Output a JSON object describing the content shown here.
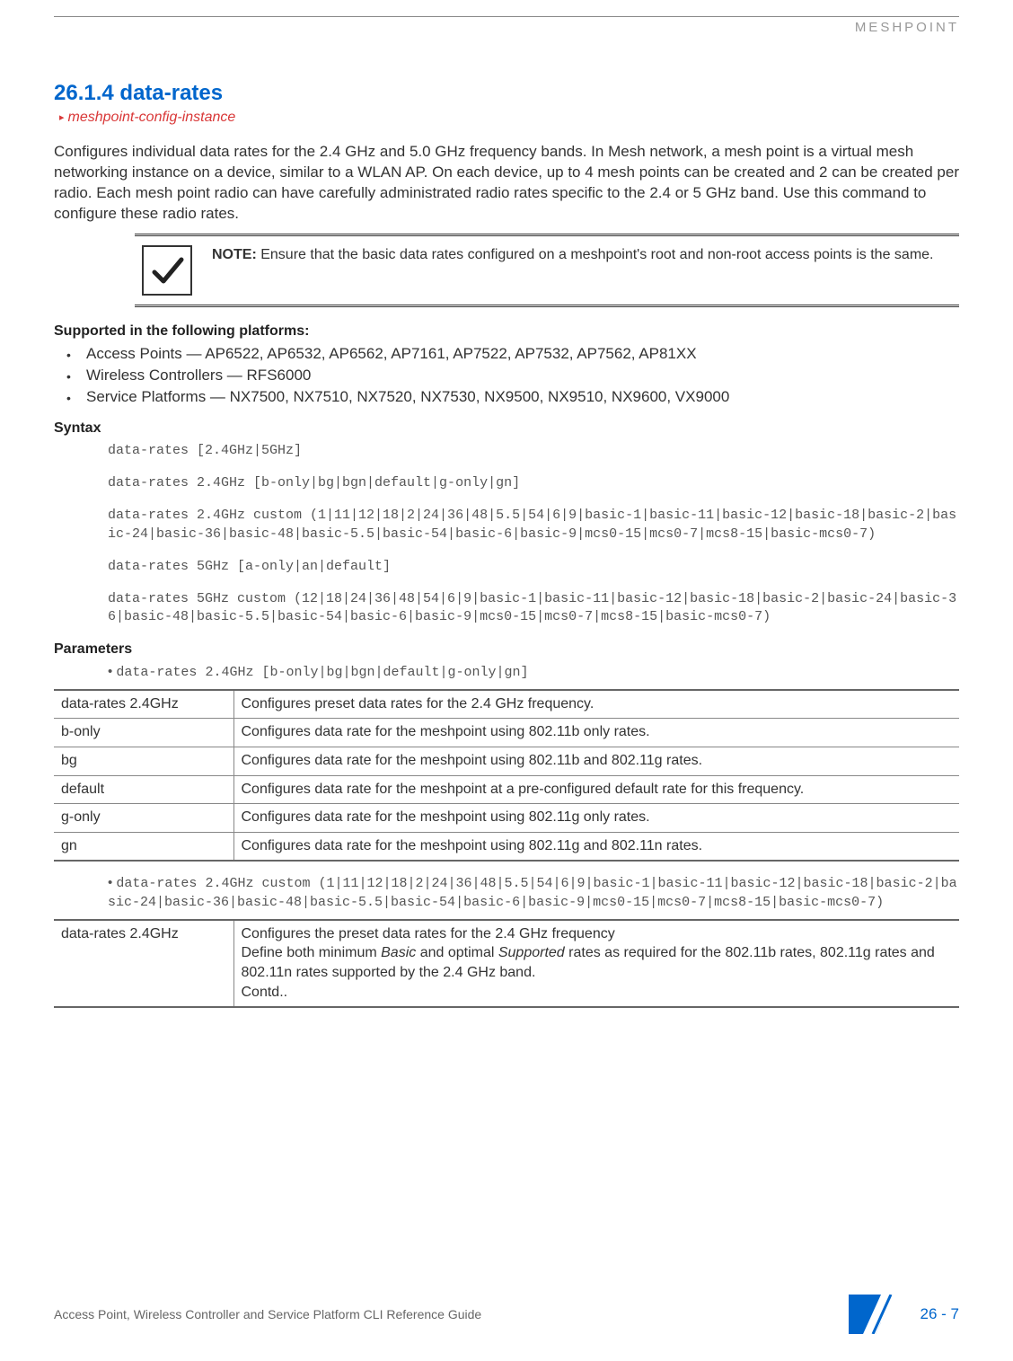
{
  "header": {
    "brand": "MESHPOINT"
  },
  "section": {
    "number": "26.1.4",
    "title": "data-rates",
    "breadcrumb": "meshpoint-config-instance",
    "intro": "Configures individual data rates for the 2.4 GHz and 5.0 GHz frequency bands. In Mesh network, a mesh point is a virtual mesh networking instance on a device, similar to a WLAN AP. On each device, up to 4 mesh points can be created and 2 can be created per radio. Each mesh point radio can have carefully administrated radio rates specific to the 2.4 or 5 GHz band. Use this command to configure these radio rates."
  },
  "note": {
    "label": "NOTE:",
    "text": " Ensure that the basic data rates configured on a meshpoint's root and non-root access points is the same."
  },
  "platforms": {
    "heading": "Supported in the following platforms:",
    "items": [
      "Access Points — AP6522, AP6532, AP6562, AP7161, AP7522, AP7532, AP7562, AP81XX",
      "Wireless Controllers — RFS6000",
      "Service Platforms — NX7500, NX7510, NX7520, NX7530, NX9500, NX9510, NX9600, VX9000"
    ]
  },
  "syntax": {
    "heading": "Syntax",
    "blocks": [
      "data-rates [2.4GHz|5GHz]",
      "data-rates 2.4GHz [b-only|bg|bgn|default|g-only|gn]",
      "data-rates 2.4GHz custom (1|11|12|18|2|24|36|48|5.5|54|6|9|basic-1|basic-11|basic-12|basic-18|basic-2|basic-24|basic-36|basic-48|basic-5.5|basic-54|basic-6|basic-9|mcs0-15|mcs0-7|mcs8-15|basic-mcs0-7)",
      "data-rates 5GHz [a-only|an|default]",
      "data-rates 5GHz custom (12|18|24|36|48|54|6|9|basic-1|basic-11|basic-12|basic-18|basic-2|basic-24|basic-36|basic-48|basic-5.5|basic-54|basic-6|basic-9|mcs0-15|mcs0-7|mcs8-15|basic-mcs0-7)"
    ]
  },
  "parameters": {
    "heading": "Parameters",
    "bullet1": "data-rates 2.4GHz [b-only|bg|bgn|default|g-only|gn]",
    "table1": [
      [
        "data-rates 2.4GHz",
        "Configures preset data rates for the 2.4 GHz frequency."
      ],
      [
        "b-only",
        "Configures data rate for the meshpoint using 802.11b only rates."
      ],
      [
        "bg",
        "Configures data rate for the meshpoint using 802.11b and 802.11g rates."
      ],
      [
        "default",
        "Configures data rate for the meshpoint at a pre-configured default rate for this frequency."
      ],
      [
        "g-only",
        "Configures data rate for the meshpoint using 802.11g only rates."
      ],
      [
        "gn",
        "Configures data rate for the meshpoint using 802.11g and 802.11n rates."
      ]
    ],
    "bullet2": "data-rates 2.4GHz custom (1|11|12|18|2|24|36|48|5.5|54|6|9|basic-1|basic-11|basic-12|basic-18|basic-2|basic-24|basic-36|basic-48|basic-5.5|basic-54|basic-6|basic-9|mcs0-15|mcs0-7|mcs8-15|basic-mcs0-7)",
    "table2_key": "data-rates 2.4GHz",
    "table2_line1": "Configures the preset data rates for the 2.4 GHz frequency",
    "table2_line2a": "Define both minimum ",
    "table2_line2b": "Basic",
    "table2_line2c": " and optimal ",
    "table2_line2d": "Supported",
    "table2_line2e": " rates as required for the 802.11b rates, 802.11g rates and 802.11n rates supported by the 2.4 GHz band.",
    "table2_line3": "Contd.."
  },
  "footer": {
    "guide": "Access Point, Wireless Controller and Service Platform CLI Reference Guide",
    "page": "26 - 7"
  }
}
